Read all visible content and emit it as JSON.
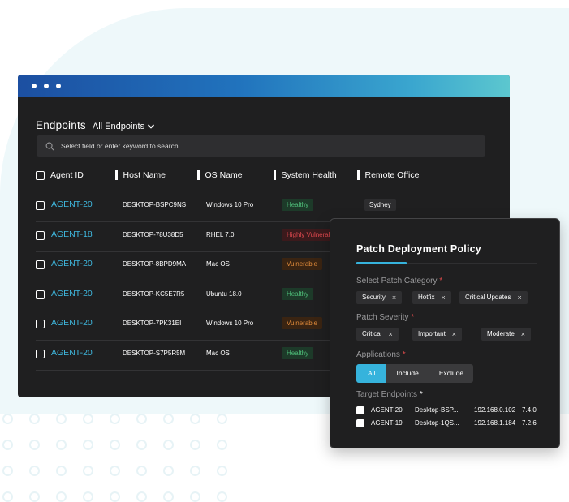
{
  "endpoints": {
    "title": "Endpoints",
    "filter_label": "All Endpoints",
    "search_placeholder": "Select field or enter keyword to search...",
    "columns": [
      "Agent ID",
      "Host Name",
      "OS Name",
      "System Health",
      "Remote Office"
    ],
    "rows": [
      {
        "agent": "AGENT-20",
        "host": "DESKTOP-BSPC9NS",
        "os": "Windows 10 Pro",
        "health": "Healthy",
        "health_type": "healthy",
        "office": "Sydney"
      },
      {
        "agent": "AGENT-18",
        "host": "DESKTOP-78U38D5",
        "os": "RHEL 7.0",
        "health": "Highly Vulnerable",
        "health_type": "high",
        "office": ""
      },
      {
        "agent": "AGENT-20",
        "host": "DESKTOP-8BPD9MA",
        "os": "Mac OS",
        "health": "Vulnerable",
        "health_type": "vuln",
        "office": ""
      },
      {
        "agent": "AGENT-20",
        "host": "DESKTOP-KC5E7R5",
        "os": "Ubuntu 18.0",
        "health": "Healthy",
        "health_type": "healthy",
        "office": ""
      },
      {
        "agent": "AGENT-20",
        "host": "DESKTOP-7PK31EI",
        "os": "Windows 10 Pro",
        "health": "Vulnerable",
        "health_type": "vuln",
        "office": ""
      },
      {
        "agent": "AGENT-20",
        "host": "DESKTOP-S7P5R5M",
        "os": "Mac OS",
        "health": "Healthy",
        "health_type": "healthy",
        "office": ""
      }
    ]
  },
  "policy": {
    "title": "Patch Deployment Policy",
    "category_label": "Select Patch Category",
    "categories": [
      "Security",
      "Hotfix",
      "Critical Updates"
    ],
    "severity_label": "Patch Severity",
    "severities": [
      "Critical",
      "Important",
      "Moderate"
    ],
    "applications_label": "Applications",
    "app_options": [
      "All",
      "Include",
      "Exclude"
    ],
    "targets_label": "Target Endpoints",
    "required_mark": "*",
    "remove_mark": "×",
    "targets": [
      {
        "agent": "AGENT-20",
        "host": "Desktop-BSP...",
        "ip": "192.168.0.102",
        "version": "7.4.0"
      },
      {
        "agent": "AGENT-19",
        "host": "Desktop-1QS...",
        "ip": "192.168.1.184",
        "version": "7.2.6"
      }
    ]
  },
  "colors": {
    "accent": "#36b3dc",
    "agent_link": "#3fb8df",
    "healthy": "#4fbf7a",
    "vulnerable": "#e18b3b",
    "highly_vulnerable": "#e0494f",
    "required": "#e24b4b",
    "panel_bg": "#1f1f20"
  }
}
